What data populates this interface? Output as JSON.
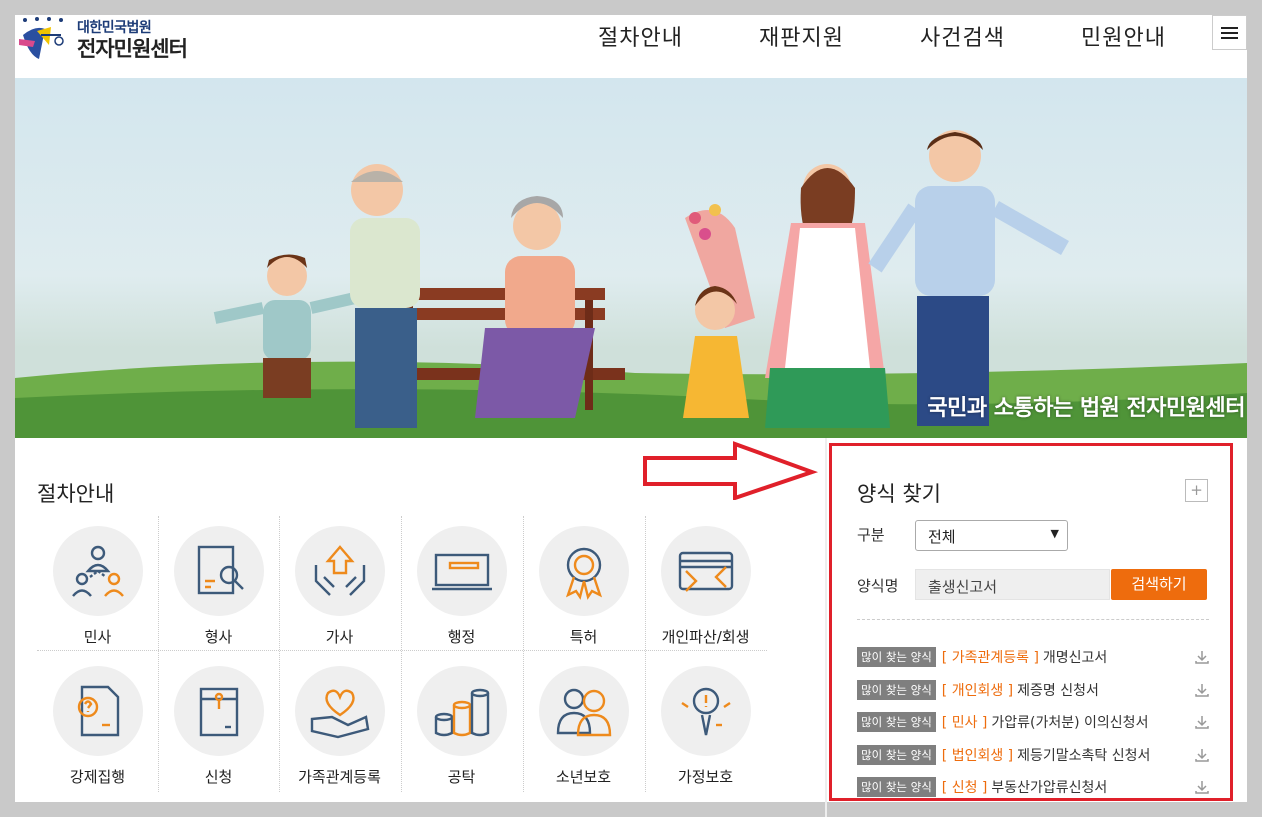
{
  "header": {
    "logo_sub": "대한민국법원",
    "logo_main": "전자민원센터",
    "nav": [
      "절차안내",
      "재판지원",
      "사건검색",
      "민원안내"
    ],
    "menu_icon": "hamburger-icon"
  },
  "hero": {
    "caption": "국민과 소통하는 법원 전자민원센터"
  },
  "procedures": {
    "title": "절차안내",
    "items": [
      {
        "label": "민사",
        "icon": "people-network-icon"
      },
      {
        "label": "형사",
        "icon": "document-search-icon"
      },
      {
        "label": "가사",
        "icon": "hands-house-icon"
      },
      {
        "label": "행정",
        "icon": "monitor-icon"
      },
      {
        "label": "특허",
        "icon": "award-medal-icon"
      },
      {
        "label": "개인파산/회생",
        "icon": "card-exchange-icon"
      },
      {
        "label": "강제집행",
        "icon": "question-document-icon"
      },
      {
        "label": "신청",
        "icon": "envelope-folder-icon"
      },
      {
        "label": "가족관계등록",
        "icon": "heart-hand-icon"
      },
      {
        "label": "공탁",
        "icon": "coins-stack-icon"
      },
      {
        "label": "소년보호",
        "icon": "two-persons-icon"
      },
      {
        "label": "가정보호",
        "icon": "magnify-person-icon"
      }
    ]
  },
  "form_search": {
    "title": "양식 찾기",
    "plus": "+",
    "category_label": "구분",
    "category_value": "전체",
    "name_label": "양식명",
    "name_value": "출생신고서",
    "search_button": "검색하기",
    "badge": "많이 찾는 양식",
    "items": [
      {
        "category": "[ 가족관계등록 ]",
        "name": "개명신고서"
      },
      {
        "category": "[ 개인회생 ]",
        "name": "제증명 신청서"
      },
      {
        "category": "[ 민사 ]",
        "name": "가압류(가처분) 이의신청서"
      },
      {
        "category": "[ 법인회생 ]",
        "name": "제등기말소촉탁 신청서"
      },
      {
        "category": "[ 신청 ]",
        "name": "부동산가압류신청서"
      }
    ]
  },
  "colors": {
    "accent_orange": "#ee6c0d",
    "highlight_red": "#e0202a",
    "icon_blue": "#3d5a7a"
  }
}
